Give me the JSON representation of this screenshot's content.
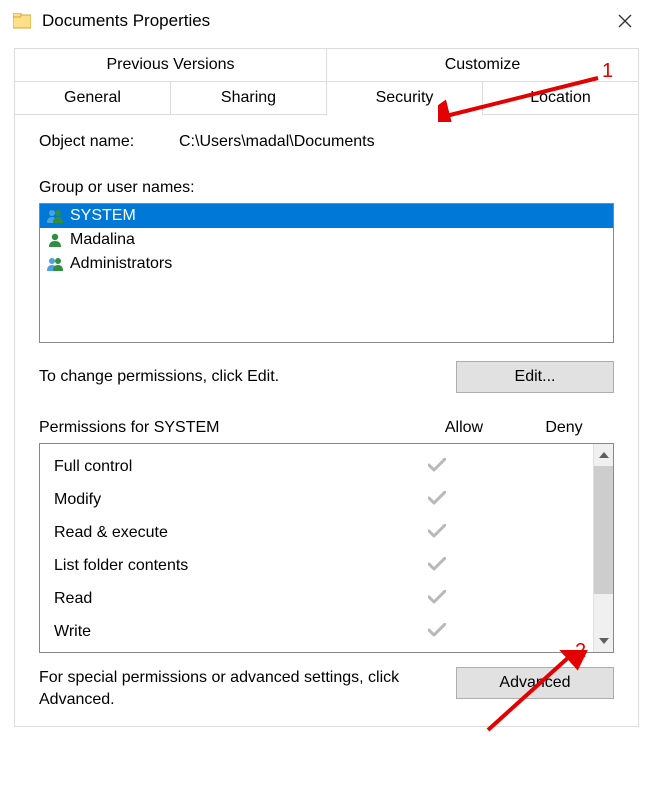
{
  "title": "Documents Properties",
  "tabs_row1": [
    "Previous Versions",
    "Customize"
  ],
  "tabs_row2": [
    "General",
    "Sharing",
    "Security",
    "Location"
  ],
  "active_tab": "Security",
  "object_name_label": "Object name:",
  "object_path": "C:\\Users\\madal\\Documents",
  "group_label": "Group or user names:",
  "users": [
    {
      "name": "SYSTEM",
      "icon": "group",
      "selected": true
    },
    {
      "name": "Madalina",
      "icon": "user",
      "selected": false
    },
    {
      "name": "Administrators",
      "icon": "group",
      "selected": false
    }
  ],
  "edit_hint": "To change permissions, click Edit.",
  "edit_button": "Edit...",
  "perm_header_label": "Permissions for SYSTEM",
  "perm_cols": {
    "allow": "Allow",
    "deny": "Deny"
  },
  "permissions": [
    {
      "name": "Full control",
      "allow": true,
      "deny": false
    },
    {
      "name": "Modify",
      "allow": true,
      "deny": false
    },
    {
      "name": "Read & execute",
      "allow": true,
      "deny": false
    },
    {
      "name": "List folder contents",
      "allow": true,
      "deny": false
    },
    {
      "name": "Read",
      "allow": true,
      "deny": false
    },
    {
      "name": "Write",
      "allow": true,
      "deny": false
    }
  ],
  "advanced_hint": "For special permissions or advanced settings, click Advanced.",
  "advanced_button": "Advanced",
  "annotations": {
    "n1": "1",
    "n2": "2"
  }
}
